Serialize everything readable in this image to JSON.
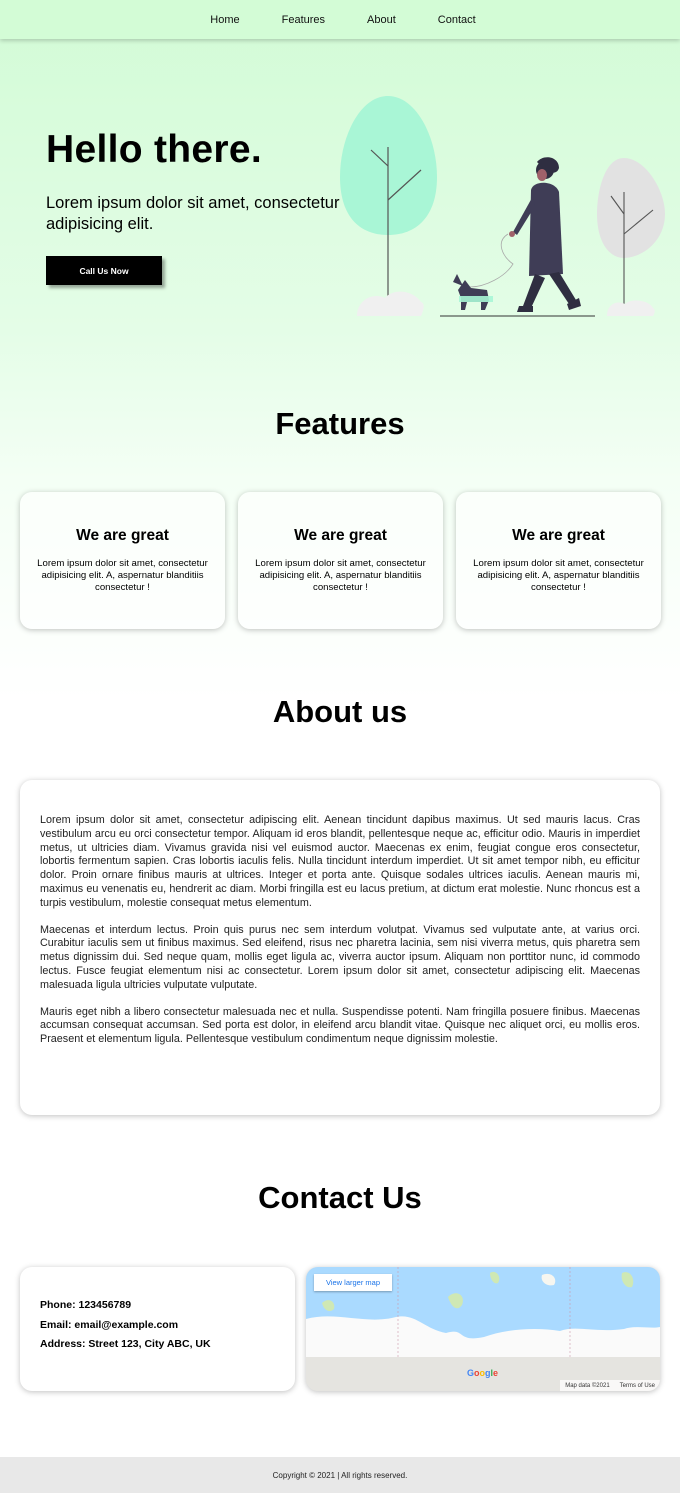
{
  "nav": {
    "items": [
      "Home",
      "Features",
      "About",
      "Contact"
    ]
  },
  "hero": {
    "title": "Hello there.",
    "subtitle": "Lorem ipsum dolor sit amet, consectetur adipisicing elit.",
    "cta_label": "Call Us Now"
  },
  "features": {
    "title": "Features",
    "cards": [
      {
        "heading": "We are great",
        "text": "Lorem ipsum dolor sit amet, consectetur adipisicing elit. A, aspernatur blanditiis consectetur !"
      },
      {
        "heading": "We are great",
        "text": "Lorem ipsum dolor sit amet, consectetur adipisicing elit. A, aspernatur blanditiis consectetur !"
      },
      {
        "heading": "We are great",
        "text": "Lorem ipsum dolor sit amet, consectetur adipisicing elit. A, aspernatur blanditiis consectetur !"
      }
    ]
  },
  "about": {
    "title": "About us",
    "paragraphs": [
      "Lorem ipsum dolor sit amet, consectetur adipiscing elit. Aenean tincidunt dapibus maximus. Ut sed mauris lacus. Cras vestibulum arcu eu orci consectetur tempor. Aliquam id eros blandit, pellentesque neque ac, efficitur odio. Mauris in imperdiet metus, ut ultricies diam. Vivamus gravida nisi vel euismod auctor. Maecenas ex enim, feugiat congue eros consectetur, lobortis fermentum sapien. Cras lobortis iaculis felis. Nulla tincidunt interdum imperdiet. Ut sit amet tempor nibh, eu efficitur dolor. Proin ornare finibus mauris at ultrices. Integer et porta ante. Quisque sodales ultrices iaculis. Aenean mauris mi, maximus eu venenatis eu, hendrerit ac diam. Morbi fringilla est eu lacus pretium, at dictum erat molestie. Nunc rhoncus est a turpis vestibulum, molestie consequat metus elementum.",
      "Maecenas et interdum lectus. Proin quis purus nec sem interdum volutpat. Vivamus sed vulputate ante, at varius orci. Curabitur iaculis sem ut finibus maximus. Sed eleifend, risus nec pharetra lacinia, sem nisi viverra metus, quis pharetra sem metus dignissim dui. Sed neque quam, mollis eget ligula ac, viverra auctor ipsum. Aliquam non porttitor nunc, id commodo lectus. Fusce feugiat elementum nisi ac consectetur. Lorem ipsum dolor sit amet, consectetur adipiscing elit. Maecenas malesuada ligula ultricies vulputate vulputate.",
      "Mauris eget nibh a libero consectetur malesuada nec et nulla. Suspendisse potenti. Nam fringilla posuere finibus. Maecenas accumsan consequat accumsan. Sed porta est dolor, in eleifend arcu blandit vitae. Quisque nec aliquet orci, eu mollis eros. Praesent et elementum ligula. Pellentesque vestibulum condimentum neque dignissim molestie."
    ]
  },
  "contact": {
    "title": "Contact Us",
    "phone": "Phone: 123456789",
    "email": "Email: email@example.com",
    "address": "Address: Street 123, City ABC, UK"
  },
  "map": {
    "view_larger": "View larger map",
    "brand": "Google",
    "map_data": "Map data ©2021",
    "terms": "Terms of Use"
  },
  "footer": {
    "copyright": "Copyright © 2021 | All rights reserved."
  },
  "colors": {
    "accent_green": "#a8f5d2",
    "hero_bg": "#d3fcd6",
    "button_bg": "#000000",
    "footer_bg": "#e8e8e8"
  }
}
